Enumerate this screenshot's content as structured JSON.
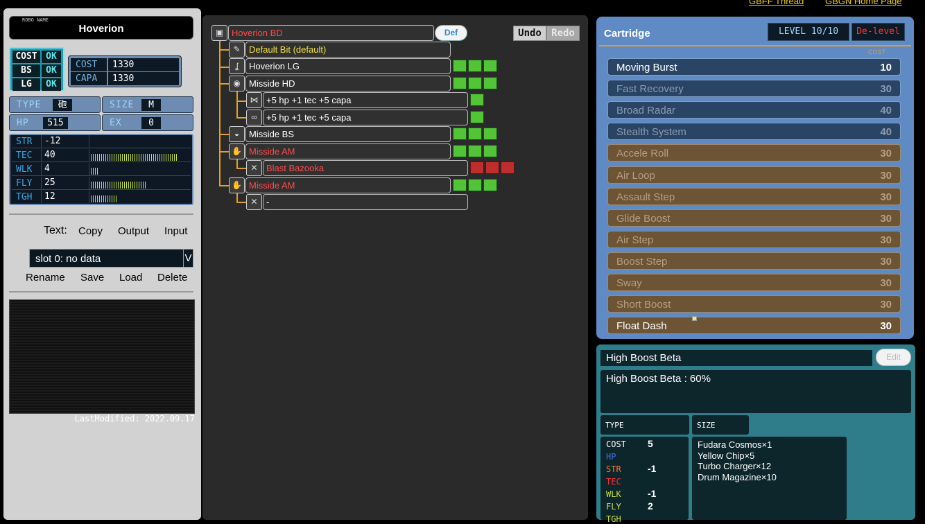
{
  "top_links": [
    "GBFF Thread",
    "GBGN Home Page"
  ],
  "left": {
    "robo_name_caption": "ROBO NAME",
    "robo_name": "Hoverion",
    "ok": [
      {
        "k": "COST",
        "v": "OK"
      },
      {
        "k": "BS",
        "v": "OK"
      },
      {
        "k": "LG",
        "v": "OK"
      }
    ],
    "cost": {
      "label": "COST",
      "value": "1330"
    },
    "capa": {
      "label": "CAPA",
      "value": "1330"
    },
    "type": {
      "label": "TYPE",
      "value": "砲"
    },
    "size": {
      "label": "SIZE",
      "value": "M"
    },
    "hp": {
      "label": "HP",
      "value": "515"
    },
    "ex": {
      "label": "EX",
      "value": "0"
    },
    "stats": [
      {
        "k": "STR",
        "v": "-12",
        "bar": 0
      },
      {
        "k": "TEC",
        "v": "40",
        "bar": 40
      },
      {
        "k": "WLK",
        "v": "4",
        "bar": 4
      },
      {
        "k": "FLY",
        "v": "25",
        "bar": 25
      },
      {
        "k": "TGH",
        "v": "12",
        "bar": 12
      }
    ],
    "text_label": "Text:",
    "copy": "Copy",
    "output": "Output",
    "input": "Input",
    "slot": "slot 0: no data",
    "slot_dd": "V",
    "rename": "Rename",
    "save": "Save",
    "load": "Load",
    "delete": "Delete",
    "last_modified": "LastModified: 2022.09.17"
  },
  "mid": {
    "def": "Def",
    "undo": "Undo",
    "redo": "Redo",
    "parts": [
      {
        "label": "Hoverion BD",
        "color": "#ff4a4a"
      },
      {
        "label": "Default Bit (default)",
        "color": "#f2e04a"
      },
      {
        "label": "Hoverion LG",
        "color": "#ffffff"
      },
      {
        "label": "Misside HD",
        "color": "#ffffff"
      },
      {
        "label": "+5 hp +1 tec +5 capa",
        "color": "#ffffff"
      },
      {
        "label": "+5 hp +1 tec +5 capa",
        "color": "#ffffff"
      },
      {
        "label": "Misside BS",
        "color": "#ffffff"
      },
      {
        "label": "Misside AM",
        "color": "#ff4a4a"
      },
      {
        "label": "Blast Bazooka",
        "color": "#ff4a4a"
      },
      {
        "label": "Misside AM",
        "color": "#ff4a4a"
      },
      {
        "label": "-",
        "color": "#ffffff"
      }
    ]
  },
  "cartridge": {
    "title": "Cartridge",
    "level": "LEVEL 10/10",
    "delevel": "De-level",
    "cost_label": "COST",
    "items": [
      {
        "name": "Moving Burst",
        "cost": "10",
        "style": "b",
        "state": "on"
      },
      {
        "name": "Fast Recovery",
        "cost": "30",
        "style": "b",
        "state": "off"
      },
      {
        "name": "Broad Radar",
        "cost": "40",
        "style": "b",
        "state": "off"
      },
      {
        "name": "Stealth System",
        "cost": "40",
        "style": "b",
        "state": "off"
      },
      {
        "name": "Accele Roll",
        "cost": "30",
        "style": "o",
        "state": "off"
      },
      {
        "name": "Air Loop",
        "cost": "30",
        "style": "o",
        "state": "off"
      },
      {
        "name": "Assault Step",
        "cost": "30",
        "style": "o",
        "state": "off"
      },
      {
        "name": "Glide Boost",
        "cost": "30",
        "style": "o",
        "state": "off"
      },
      {
        "name": "Air Step",
        "cost": "30",
        "style": "o",
        "state": "off"
      },
      {
        "name": "Boost Step",
        "cost": "30",
        "style": "o",
        "state": "off"
      },
      {
        "name": "Sway",
        "cost": "30",
        "style": "o",
        "state": "off"
      },
      {
        "name": "Short Boost",
        "cost": "30",
        "style": "o",
        "state": "off"
      },
      {
        "name": "Float Dash",
        "cost": "30",
        "style": "o",
        "state": "on"
      }
    ]
  },
  "skill": {
    "name": "High Boost Beta",
    "edit": "Edit",
    "desc": "High Boost Beta : 60%",
    "type_label": "TYPE",
    "size_label": "SIZE",
    "stats": [
      {
        "k": "COST",
        "v": "5",
        "c": "#ffffff"
      },
      {
        "k": "HP",
        "v": "",
        "c": "#3f6fe0"
      },
      {
        "k": "STR",
        "v": "-1",
        "c": "#ff7a2a"
      },
      {
        "k": "TEC",
        "v": "",
        "c": "#ff3030"
      },
      {
        "k": "WLK",
        "v": "-1",
        "c": "#c7e23a"
      },
      {
        "k": "FLY",
        "v": "2",
        "c": "#c7e23a"
      },
      {
        "k": "TGH",
        "v": "",
        "c": "#c7e23a"
      }
    ],
    "materials": [
      "Fudara Cosmos×1",
      "Yellow Chip×5",
      "Turbo Charger×12",
      "Drum Magazine×10"
    ]
  }
}
